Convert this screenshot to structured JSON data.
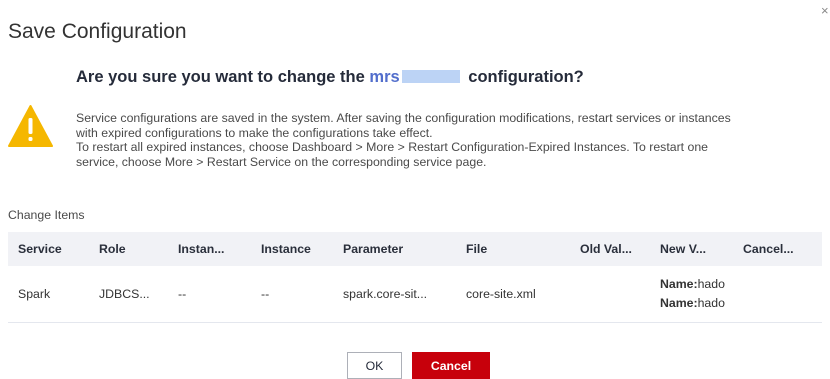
{
  "dialog": {
    "title": "Save Configuration",
    "close_label": "×"
  },
  "question": {
    "prefix": "Are you sure you want to change the",
    "service_name": "mrs",
    "suffix": "configuration?"
  },
  "description": {
    "lines": [
      "Service configurations are saved in the system. After saving the configuration modifications, restart services or instances",
      "with expired configurations to make the configurations take effect.",
      "To restart all expired instances, choose Dashboard > More > Restart Configuration-Expired Instances. To restart one",
      "service, choose More > Restart Service on the corresponding service page."
    ]
  },
  "change_items": {
    "label": "Change Items",
    "columns": [
      "Service",
      "Role",
      "Instan...",
      "Instance",
      "Parameter",
      "File",
      "Old Val...",
      "New V...",
      "Cancel..."
    ],
    "rows": [
      {
        "service": "Spark",
        "role": "JDBCS...",
        "instance_group": "--",
        "instance": "--",
        "parameter": "spark.core-sit...",
        "file": "core-site.xml",
        "old_value": "",
        "new_value": [
          {
            "key": "Name:",
            "value": "hado"
          },
          {
            "key": "Name:",
            "value": "hado"
          }
        ],
        "cancel": ""
      }
    ]
  },
  "buttons": {
    "ok": "OK",
    "cancel": "Cancel"
  },
  "colors": {
    "accent_link": "#526ecc",
    "cancel_button": "#c7000b",
    "warning_icon": "#f5b700",
    "table_header_bg": "#f1f2f6"
  },
  "icons": {
    "warning": "warning-triangle-icon",
    "close": "close-icon"
  }
}
